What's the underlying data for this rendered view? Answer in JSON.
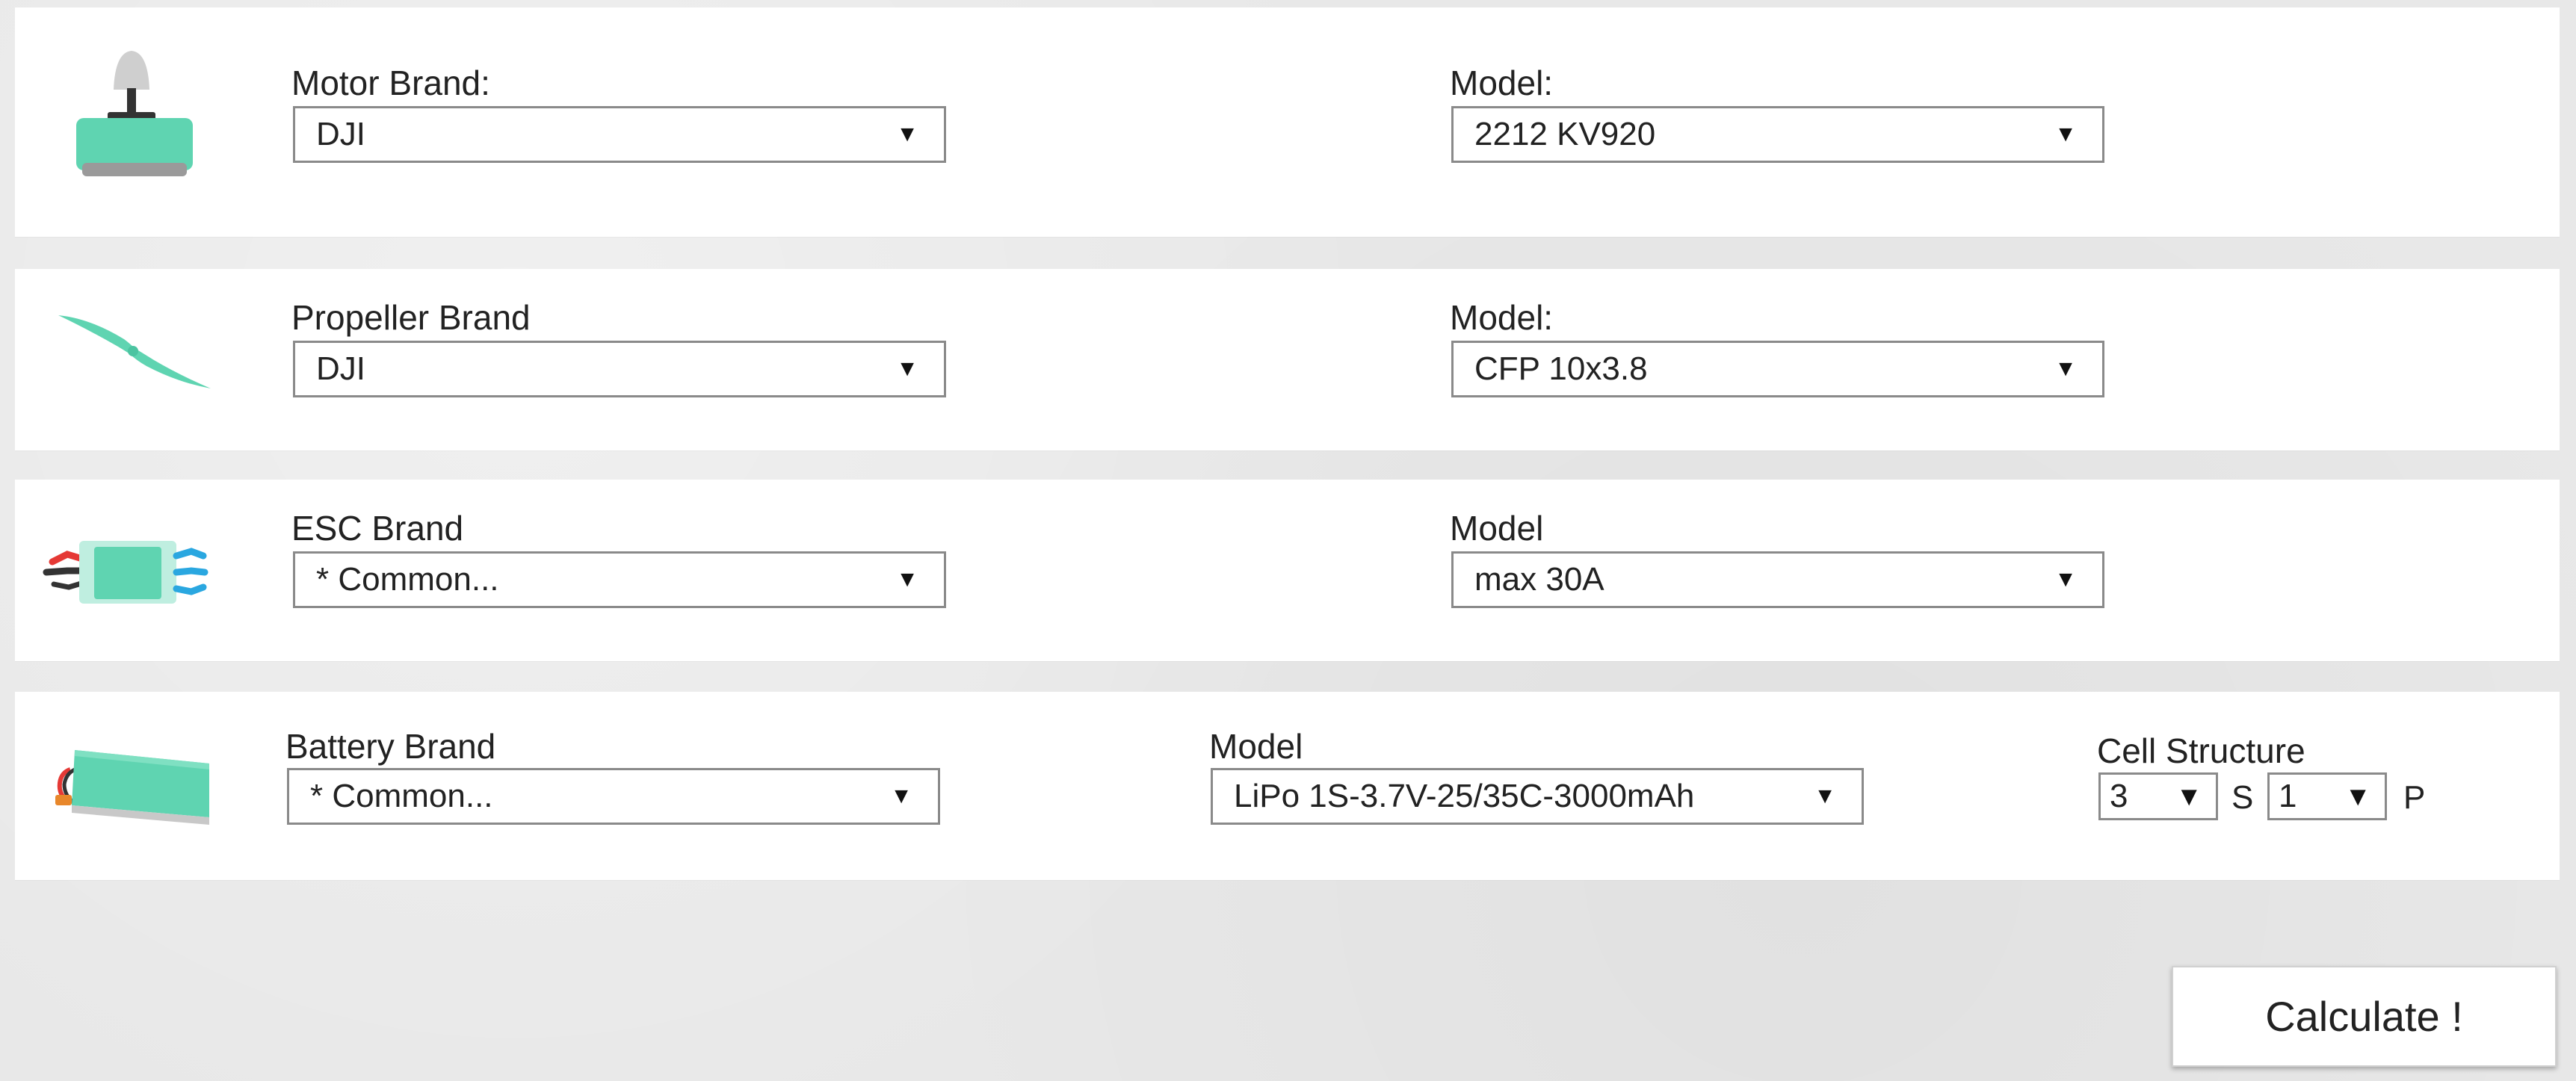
{
  "colors": {
    "accent": "#5fd4b1",
    "panel": "#ffffff",
    "background": "#e8e8e8"
  },
  "motor": {
    "icon": "motor-icon",
    "brand_label": "Motor Brand:",
    "brand_value": "DJI",
    "model_label": "Model:",
    "model_value": "2212 KV920"
  },
  "propeller": {
    "icon": "propeller-icon",
    "brand_label": "Propeller Brand",
    "brand_value": "DJI",
    "model_label": "Model:",
    "model_value": "CFP 10x3.8"
  },
  "esc": {
    "icon": "esc-icon",
    "brand_label": "ESC Brand",
    "brand_value": "* Common...",
    "model_label": "Model",
    "model_value": "max 30A"
  },
  "battery": {
    "icon": "battery-icon",
    "brand_label": "Battery Brand",
    "brand_value": "* Common...",
    "model_label": "Model",
    "model_value": "LiPo 1S-3.7V-25/35C-3000mAh",
    "cell_label": "Cell Structure",
    "series_value": "3",
    "series_unit": "S",
    "parallel_value": "1",
    "parallel_unit": "P"
  },
  "dropdown_arrow": "▼",
  "calculate_label": "Calculate !"
}
